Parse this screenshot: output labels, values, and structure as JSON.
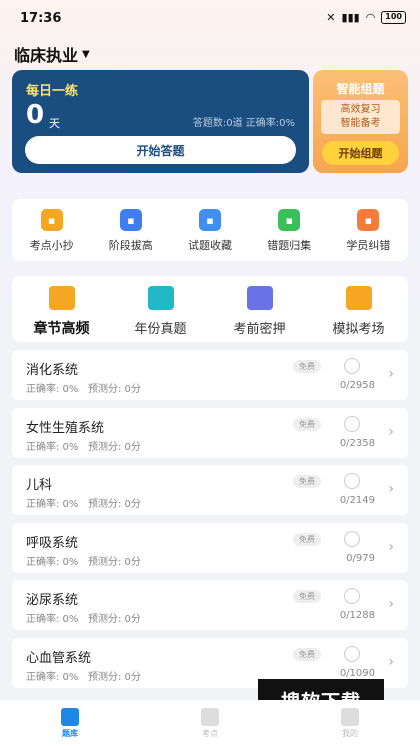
{
  "status": {
    "time": "17:36",
    "battery": "100"
  },
  "header": {
    "title": "临床执业"
  },
  "daily": {
    "title": "每日一练",
    "days": "0",
    "unit": "天",
    "answered": "答题数:0道",
    "accuracy": "正确率:0%",
    "button": "开始答题"
  },
  "smart": {
    "title": "智能组题",
    "line1": "高效复习",
    "line2": "智能备考",
    "button": "开始组题"
  },
  "tools": [
    {
      "label": "考点小抄",
      "icon": "notes-icon",
      "color": "#f5a623"
    },
    {
      "label": "阶段拔高",
      "icon": "bar-chart-icon",
      "color": "#3f7ef0"
    },
    {
      "label": "试题收藏",
      "icon": "star-icon",
      "color": "#3f8ef0"
    },
    {
      "label": "错题归集",
      "icon": "folder-icon",
      "color": "#3bbf59"
    },
    {
      "label": "学员纠错",
      "icon": "wrench-icon",
      "color": "#f37c3a"
    }
  ],
  "categories": [
    {
      "label": "章节高频",
      "color": "#f5a623"
    },
    {
      "label": "年份真题",
      "color": "#22b8c8"
    },
    {
      "label": "考前密押",
      "color": "#6a72e8"
    },
    {
      "label": "模拟考场",
      "color": "#f5a623"
    }
  ],
  "chapters": [
    {
      "name": "消化系统",
      "accuracy": "正确率: 0%",
      "predicted": "预测分: 0分",
      "badge": "免费",
      "progress": "0/2958"
    },
    {
      "name": "女性生殖系统",
      "accuracy": "正确率: 0%",
      "predicted": "预测分: 0分",
      "badge": "免费",
      "progress": "0/2358"
    },
    {
      "name": "儿科",
      "accuracy": "正确率: 0%",
      "predicted": "预测分: 0分",
      "badge": "免费",
      "progress": "0/2149"
    },
    {
      "name": "呼吸系统",
      "accuracy": "正确率: 0%",
      "predicted": "预测分: 0分",
      "badge": "免费",
      "progress": "0/979"
    },
    {
      "name": "泌尿系统",
      "accuracy": "正确率: 0%",
      "predicted": "预测分: 0分",
      "badge": "免费",
      "progress": "0/1288"
    },
    {
      "name": "心血管系统",
      "accuracy": "正确率: 0%",
      "predicted": "预测分: 0分",
      "badge": "免费",
      "progress": "0/1090"
    }
  ],
  "nav": [
    {
      "label": "题库",
      "active": true
    },
    {
      "label": "考点",
      "active": false
    },
    {
      "label": "我的",
      "active": false
    }
  ],
  "watermark": "搜软下载",
  "colors": {
    "primary": "#1b4e80",
    "accent": "#f7a54f",
    "active_nav": "#1e88e5"
  }
}
